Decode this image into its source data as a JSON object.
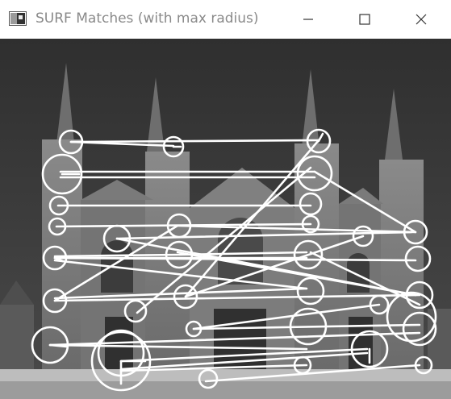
{
  "window": {
    "title": "SURF Matches (with max radius)",
    "icons": {
      "app": "opencv-window-icon",
      "minimize": "minimize-icon",
      "maximize": "maximize-icon",
      "close": "close-icon"
    }
  },
  "image": {
    "description_colors": {
      "sky": "#3e3e3e",
      "building": "#7d7d7d",
      "marker": "#ffffff"
    }
  }
}
